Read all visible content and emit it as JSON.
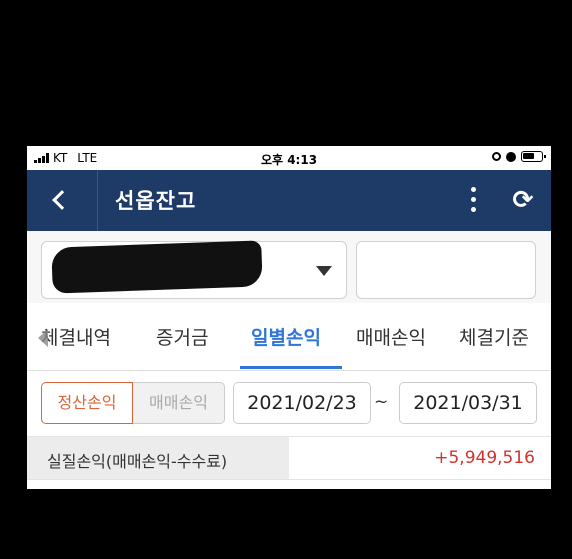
{
  "status": {
    "carrier": "KT",
    "network": "LTE",
    "time": "오후 4:13"
  },
  "header": {
    "title": "선옵잔고",
    "refresh_icon": "⟳"
  },
  "account": {
    "number_visible": "14"
  },
  "tabs": [
    {
      "label": "체결내역",
      "active": false
    },
    {
      "label": "증거금",
      "active": false
    },
    {
      "label": "일별손익",
      "active": true
    },
    {
      "label": "매매손익",
      "active": false
    },
    {
      "label": "체결기준",
      "active": false
    }
  ],
  "filter": {
    "toggle": [
      "정산손익",
      "매매손익"
    ],
    "date_from": "2021/02/23",
    "separator": "~",
    "date_to": "2021/03/31"
  },
  "summary": {
    "label": "실질손익(매매손익-수수료)",
    "value": "+5,949,516"
  },
  "colors": {
    "header_bg": "#1e3a66",
    "active_tab": "#2f76d6",
    "selected_toggle": "#d9653a",
    "profit": "#d2322d"
  }
}
